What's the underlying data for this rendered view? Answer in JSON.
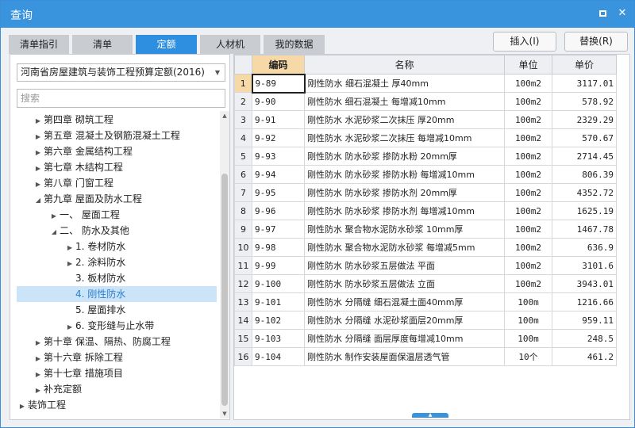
{
  "window": {
    "title": "查询"
  },
  "tabs": [
    {
      "label": "清单指引",
      "active": false
    },
    {
      "label": "清单",
      "active": false
    },
    {
      "label": "定额",
      "active": true
    },
    {
      "label": "人材机",
      "active": false
    },
    {
      "label": "我的数据",
      "active": false
    }
  ],
  "actions": {
    "insert": "插入(I)",
    "replace": "替换(R)"
  },
  "left": {
    "quota_select": "河南省房屋建筑与装饰工程预算定额(2016)",
    "search_placeholder": "搜索",
    "tree": [
      {
        "label": "第四章 砌筑工程",
        "arrow": "collapsed",
        "level": 1
      },
      {
        "label": "第五章 混凝土及钢筋混凝土工程",
        "arrow": "collapsed",
        "level": 1
      },
      {
        "label": "第六章 金属结构工程",
        "arrow": "collapsed",
        "level": 1
      },
      {
        "label": "第七章 木结构工程",
        "arrow": "collapsed",
        "level": 1
      },
      {
        "label": "第八章 门窗工程",
        "arrow": "collapsed",
        "level": 1
      },
      {
        "label": "第九章 屋面及防水工程",
        "arrow": "expanded",
        "level": 1
      },
      {
        "label": "一、 屋面工程",
        "arrow": "collapsed",
        "level": 2
      },
      {
        "label": "二、 防水及其他",
        "arrow": "expanded",
        "level": 2
      },
      {
        "label": "1. 卷材防水",
        "arrow": "collapsed",
        "level": 3
      },
      {
        "label": "2. 涂料防水",
        "arrow": "collapsed",
        "level": 3
      },
      {
        "label": "3. 板材防水",
        "arrow": "none",
        "level": 3
      },
      {
        "label": "4. 刚性防水",
        "arrow": "none",
        "level": 3,
        "selected": true
      },
      {
        "label": "5. 屋面排水",
        "arrow": "none",
        "level": 3
      },
      {
        "label": "6. 变形缝与止水带",
        "arrow": "collapsed",
        "level": 3
      },
      {
        "label": "第十章 保温、隔热、防腐工程",
        "arrow": "collapsed",
        "level": 1
      },
      {
        "label": "第十六章 拆除工程",
        "arrow": "collapsed",
        "level": 1
      },
      {
        "label": "第十七章 措施项目",
        "arrow": "collapsed",
        "level": 1
      },
      {
        "label": "补充定额",
        "arrow": "collapsed",
        "level": 1
      },
      {
        "label": "装饰工程",
        "arrow": "collapsed",
        "level": 0
      }
    ]
  },
  "table": {
    "headers": {
      "code": "编码",
      "name": "名称",
      "unit": "单位",
      "price": "单价"
    },
    "rows": [
      {
        "n": "1",
        "code": "9-89",
        "name": "刚性防水 细石混凝土 厚40mm",
        "unit": "100m2",
        "price": "3117.01"
      },
      {
        "n": "2",
        "code": "9-90",
        "name": "刚性防水 细石混凝土 每增减10mm",
        "unit": "100m2",
        "price": "578.92"
      },
      {
        "n": "3",
        "code": "9-91",
        "name": "刚性防水 水泥砂浆二次抹压 厚20mm",
        "unit": "100m2",
        "price": "2329.29"
      },
      {
        "n": "4",
        "code": "9-92",
        "name": "刚性防水 水泥砂浆二次抹压 每增减10mm",
        "unit": "100m2",
        "price": "570.67"
      },
      {
        "n": "5",
        "code": "9-93",
        "name": "刚性防水 防水砂浆 掺防水粉 20mm厚",
        "unit": "100m2",
        "price": "2714.45"
      },
      {
        "n": "6",
        "code": "9-94",
        "name": "刚性防水 防水砂浆 掺防水粉 每增减10mm",
        "unit": "100m2",
        "price": "806.39"
      },
      {
        "n": "7",
        "code": "9-95",
        "name": "刚性防水 防水砂浆 掺防水剂 20mm厚",
        "unit": "100m2",
        "price": "4352.72"
      },
      {
        "n": "8",
        "code": "9-96",
        "name": "刚性防水 防水砂浆 掺防水剂 每增减10mm",
        "unit": "100m2",
        "price": "1625.19"
      },
      {
        "n": "9",
        "code": "9-97",
        "name": "刚性防水 聚合物水泥防水砂浆 10mm厚",
        "unit": "100m2",
        "price": "1467.78"
      },
      {
        "n": "10",
        "code": "9-98",
        "name": "刚性防水 聚合物水泥防水砂浆 每增减5mm",
        "unit": "100m2",
        "price": "636.9"
      },
      {
        "n": "11",
        "code": "9-99",
        "name": "刚性防水 防水砂浆五层做法 平面",
        "unit": "100m2",
        "price": "3101.6"
      },
      {
        "n": "12",
        "code": "9-100",
        "name": "刚性防水 防水砂浆五层做法 立面",
        "unit": "100m2",
        "price": "3943.01"
      },
      {
        "n": "13",
        "code": "9-101",
        "name": "刚性防水 分隔缝 细石混凝土面40mm厚",
        "unit": "100m",
        "price": "1216.66"
      },
      {
        "n": "14",
        "code": "9-102",
        "name": "刚性防水 分隔缝 水泥砂浆面层20mm厚",
        "unit": "100m",
        "price": "959.11"
      },
      {
        "n": "15",
        "code": "9-103",
        "name": "刚性防水 分隔缝 面层厚度每增减10mm",
        "unit": "100m",
        "price": "248.5"
      },
      {
        "n": "16",
        "code": "9-104",
        "name": "刚性防水 制作安装屋面保温层透气管",
        "unit": "10个",
        "price": "461.2"
      }
    ]
  }
}
